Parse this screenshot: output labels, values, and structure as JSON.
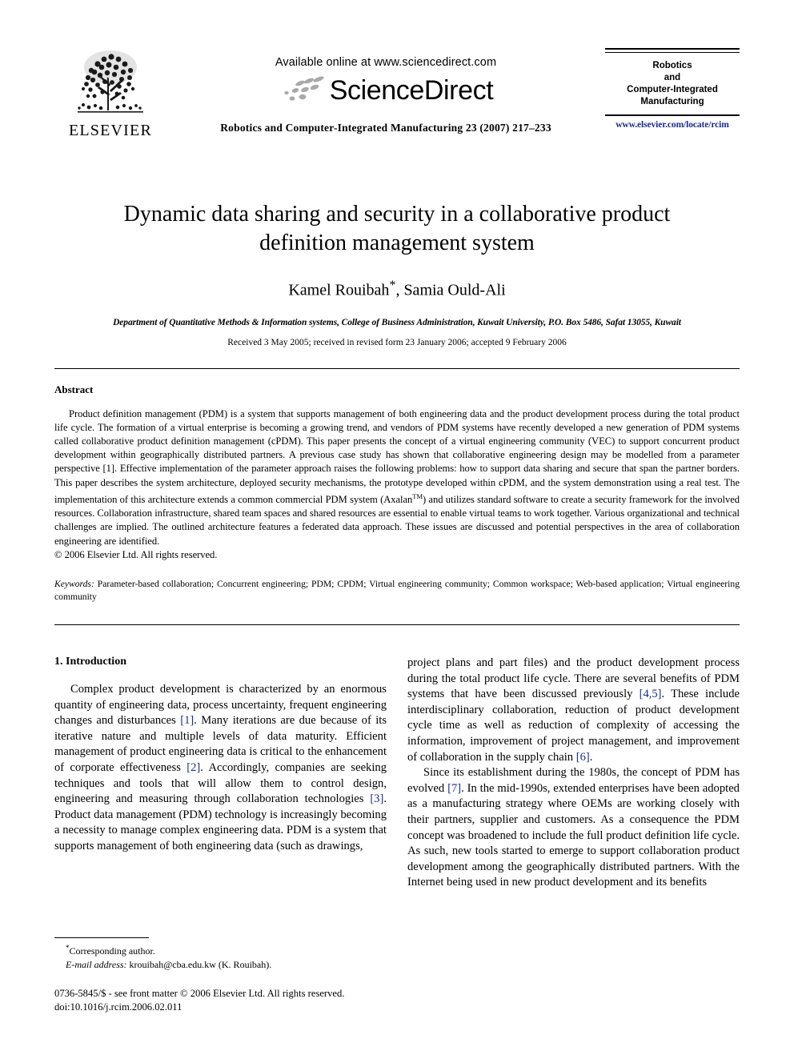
{
  "masthead": {
    "publisher_name": "ELSEVIER",
    "available_online": "Available online at www.sciencedirect.com",
    "sciencedirect_wordmark": "ScienceDirect",
    "journal_citation": "Robotics and Computer-Integrated Manufacturing 23 (2007) 217–233",
    "journal_box": {
      "line1": "Robotics",
      "line2": "and",
      "line3": "Computer-Integrated",
      "line4": "Manufacturing",
      "url": "www.elsevier.com/locate/rcim",
      "url_color": "#1a2b8c"
    }
  },
  "article": {
    "title": "Dynamic data sharing and security in a collaborative product definition management system",
    "authors": "Kamel Rouibah*, Samia Ould-Ali",
    "authors_name_1": "Kamel Rouibah",
    "authors_star": "*",
    "authors_name_2": ", Samia Ould-Ali",
    "affiliation": "Department of Quantitative Methods & Information systems, College of Business Administration, Kuwait University, P.O. Box 5486, Safat 13055, Kuwait",
    "history": "Received 3 May 2005; received in revised form 23 January 2006; accepted 9 February 2006"
  },
  "abstract": {
    "heading": "Abstract",
    "text_part1": "Product definition management (PDM) is a system that supports management of both engineering data and the product development process during the total product life cycle. The formation of a virtual enterprise is becoming a growing trend, and vendors of PDM systems have recently developed a new generation of PDM systems called collaborative product definition management (cPDM). This paper presents the concept of a virtual engineering community (VEC) to support concurrent product development within geographically distributed partners. A previous case study has shown that collaborative engineering design may be modelled from a parameter perspective [1]. Effective implementation of the parameter approach raises the following problems: how to support data sharing and secure that span the partner borders. This paper describes the system architecture, deployed security mechanisms, the prototype developed within cPDM, and the system demonstration using a real test. The implementation of this architecture extends a common commercial PDM system (Axalan",
    "trademark": "TM",
    "text_part2": ") and utilizes standard software to create a security framework for the involved resources. Collaboration infrastructure, shared team spaces and shared resources are essential to enable virtual teams to work together. Various organizational and technical challenges are implied. The outlined architecture features a federated data approach. These issues are discussed and potential perspectives in the area of collaboration engineering are identified.",
    "copyright": "© 2006 Elsevier Ltd. All rights reserved.",
    "keywords_label": "Keywords:",
    "keywords_value": " Parameter-based collaboration; Concurrent engineering; PDM; CPDM; Virtual engineering community; Common workspace; Web-based application; Virtual engineering community"
  },
  "body": {
    "section_heading": "1.  Introduction",
    "left_column": {
      "para1_a": "Complex product development is characterized by an enormous quantity of engineering data, process uncertainty, frequent engineering changes and disturbances ",
      "ref1": "[1]",
      "para1_b": ". Many iterations are due because of its iterative nature and multiple levels of data maturity. Efficient management of product engineering data is critical to the enhancement of corporate effectiveness ",
      "ref2": "[2]",
      "para1_c": ". Accordingly, companies are seeking techniques and tools that will allow them to control design, engineering and measuring through collaboration technologies ",
      "ref3": "[3]",
      "para1_d": ". Product data management (PDM) technology is increasingly becoming a necessity to manage complex engineering data. PDM is a system that supports management of both engineering data (such as drawings,"
    },
    "right_column": {
      "para1_cont_a": "project plans and part files) and the product development process during the total product life cycle. There are several benefits of PDM systems that have been discussed previously ",
      "ref45": "[4,5]",
      "para1_cont_b": ". These include interdisciplinary collaboration, reduction of product development cycle time as well as reduction of complexity of accessing the information, improvement of project management, and improvement of collaboration in the supply chain ",
      "ref6": "[6]",
      "para1_cont_c": ".",
      "para2_a": "Since its establishment during the 1980s, the concept of PDM has evolved ",
      "ref7": "[7]",
      "para2_b": ". In the mid-1990s, extended enterprises have been adopted as a manufacturing strategy where OEMs are working closely with their partners, supplier and customers. As a consequence the PDM concept was broadened to include the full product definition life cycle. As such, new tools started to emerge to support collaboration product development among the geographically distributed partners. With the Internet being used in new product development and its benefits"
    }
  },
  "footer": {
    "corresponding_author": "Corresponding author.",
    "corresponding_star": "*",
    "email_label": "E-mail address:",
    "email_value": " krouibah@cba.edu.kw (K. Rouibah).",
    "issn_line": "0736-5845/$ - see front matter © 2006 Elsevier Ltd. All rights reserved.",
    "doi_line": "doi:10.1016/j.rcim.2006.02.011"
  }
}
